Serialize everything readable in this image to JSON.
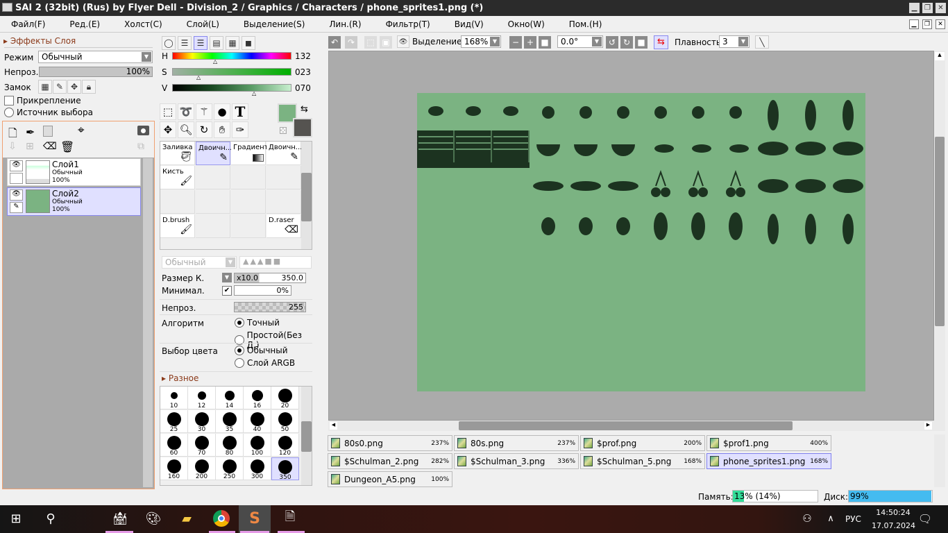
{
  "title": "SAI 2 (32bit) (Rus) by Flyer Dell - Division_2 / Graphics / Characters / phone_sprites1.png (*)",
  "menu": [
    "Файл(F)",
    "Ред.(E)",
    "Холст(C)",
    "Слой(L)",
    "Выделение(S)",
    "Лин.(R)",
    "Фильтр(T)",
    "Вид(V)",
    "Окно(W)",
    "Пом.(H)"
  ],
  "layer_panel": {
    "effects": "Эффекты Слоя",
    "mode_label": "Режим",
    "mode_value": "Обычный",
    "opacity_label": "Непроз.",
    "opacity_value": "100%",
    "opacity": 1.0,
    "lock_label": "Замок",
    "attach_label": "Прикрепление",
    "source_label": "Источник выбора",
    "layers": [
      {
        "name": "Слой1",
        "mode": "Обычный",
        "opacity": "100%"
      },
      {
        "name": "Слой2",
        "mode": "Обычный",
        "opacity": "100%"
      }
    ]
  },
  "color": {
    "h_label": "H",
    "h_value": "132",
    "s_label": "S",
    "s_value": "023",
    "v_label": "V",
    "v_value": "070",
    "primary": "#7bb382",
    "secondary": "#555350"
  },
  "brushes": [
    {
      "name": "Заливка"
    },
    {
      "name": "Двоичн..."
    },
    {
      "name": "Градиент"
    },
    {
      "name": "Двоичн..."
    },
    {
      "name": "Кисть"
    },
    {
      "name": "D.brush"
    },
    {
      "name": "D.raser"
    }
  ],
  "tool_settings": {
    "blend": "Обычный",
    "size_label": "Размер К.",
    "size_mult": "x10.0",
    "size_value": "350.0",
    "min_label": "Минимал.",
    "min_value": "0%",
    "opacity_label": "Непроз.",
    "opacity_value": "255",
    "algo_label": "Алгоритм",
    "algo_opt1": "Точный",
    "algo_opt2": "Простой(Без Д.)",
    "pick_label": "Выбор цвета",
    "pick_opt1": "Обычный",
    "pick_opt2": "Слой ARGB",
    "misc": "Разное"
  },
  "brush_sizes": [
    "10",
    "12",
    "14",
    "16",
    "20",
    "25",
    "30",
    "35",
    "40",
    "50",
    "60",
    "70",
    "80",
    "100",
    "120",
    "160",
    "200",
    "250",
    "300",
    "350"
  ],
  "toolbar": {
    "selection_label": "Выделение",
    "zoom": "168%",
    "angle": "0.0°",
    "smooth_label": "Плавность",
    "smooth_value": "3"
  },
  "files": [
    {
      "name": "80s0.png",
      "zoom": "237%"
    },
    {
      "name": "80s.png",
      "zoom": "237%"
    },
    {
      "name": "$prof.png",
      "zoom": "200%"
    },
    {
      "name": "$prof1.png",
      "zoom": "400%"
    },
    {
      "name": "$Schulman_2.png",
      "zoom": "282%"
    },
    {
      "name": "$Schulman_3.png",
      "zoom": "336%"
    },
    {
      "name": "$Schulman_5.png",
      "zoom": "168%"
    },
    {
      "name": "phone_sprites1.png",
      "zoom": "168%"
    },
    {
      "name": "Dungeon_A5.png",
      "zoom": "100%"
    }
  ],
  "status": {
    "memory_label": "Память:",
    "memory_value": "13% (14%)",
    "memory": 0.13,
    "disk_label": "Диск:",
    "disk_value": "99%",
    "disk": 0.99
  },
  "taskbar": {
    "lang": "РУС",
    "time": "14:50:24",
    "date": "17.07.2024"
  }
}
